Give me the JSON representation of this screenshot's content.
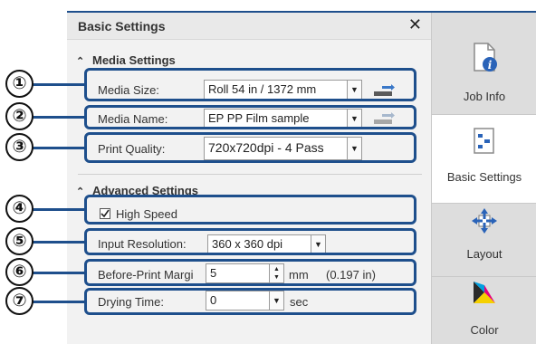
{
  "panel": {
    "title": "Basic Settings",
    "close_glyph": "✕"
  },
  "media_settings": {
    "heading": "Media Settings",
    "media_size": {
      "label": "Media Size:",
      "value": "Roll 54 in / 1372 mm"
    },
    "media_name": {
      "label": "Media Name:",
      "value": "EP PP Film sample"
    },
    "print_quality": {
      "label": "Print Quality:",
      "value": "720x720dpi - 4 Pass"
    }
  },
  "advanced_settings": {
    "heading": "Advanced Settings",
    "high_speed": {
      "label": "High Speed",
      "checked": true
    },
    "input_resolution": {
      "label": "Input Resolution:",
      "value": "360 x 360 dpi"
    },
    "before_print_margin": {
      "label": "Before-Print Margi",
      "value": "5",
      "unit": "mm",
      "converted": "(0.197 in)"
    },
    "drying_time": {
      "label": "Drying Time:",
      "value": "0",
      "unit": "sec"
    }
  },
  "callouts": [
    "①",
    "②",
    "③",
    "④",
    "⑤",
    "⑥",
    "⑦"
  ],
  "tabs": [
    {
      "label": "Job Info",
      "icon": "job-info-icon"
    },
    {
      "label": "Basic Settings",
      "icon": "basic-settings-icon",
      "active": true
    },
    {
      "label": "Layout",
      "icon": "layout-icon"
    },
    {
      "label": "Color",
      "icon": "color-icon"
    }
  ],
  "colors": {
    "highlight": "#1e4f8c",
    "panel_bg": "#f2f2f2",
    "tab_bg": "#dddddd"
  }
}
